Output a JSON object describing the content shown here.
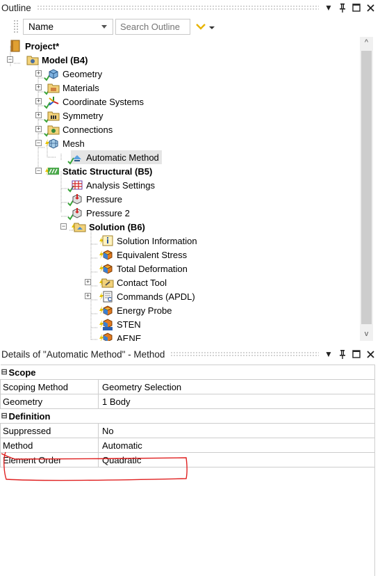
{
  "outline": {
    "title": "Outline",
    "column_select": "Name",
    "search_placeholder": "Search Outline",
    "tree": [
      {
        "label": "Project*",
        "bold": true
      },
      {
        "label": "Model (B4)",
        "bold": true
      },
      {
        "label": "Geometry"
      },
      {
        "label": "Materials"
      },
      {
        "label": "Coordinate Systems"
      },
      {
        "label": "Symmetry"
      },
      {
        "label": "Connections"
      },
      {
        "label": "Mesh"
      },
      {
        "label": "Automatic Method"
      },
      {
        "label": "Static Structural (B5)",
        "bold": true
      },
      {
        "label": "Analysis Settings"
      },
      {
        "label": "Pressure"
      },
      {
        "label": "Pressure 2"
      },
      {
        "label": "Solution (B6)",
        "bold": true
      },
      {
        "label": "Solution Information"
      },
      {
        "label": "Equivalent Stress"
      },
      {
        "label": "Total Deformation"
      },
      {
        "label": "Contact Tool"
      },
      {
        "label": "Commands (APDL)"
      },
      {
        "label": "Energy Probe"
      },
      {
        "label": "STEN"
      },
      {
        "label": "AENE"
      }
    ]
  },
  "details": {
    "title": "Details of \"Automatic Method\" - Method",
    "groups": [
      {
        "name": "Scope",
        "rows": [
          {
            "key": "Scoping Method",
            "value": "Geometry Selection"
          },
          {
            "key": "Geometry",
            "value": "1 Body"
          }
        ]
      },
      {
        "name": "Definition",
        "rows": [
          {
            "key": "Suppressed",
            "value": "No"
          },
          {
            "key": "Method",
            "value": "Automatic"
          },
          {
            "key": "Element Order",
            "value": "Quadratic"
          }
        ]
      }
    ]
  },
  "icons": {
    "pin": "pin-icon",
    "maximize": "maximize-icon",
    "close": "close-icon",
    "dropdown": "chevron-down-icon",
    "filter": "filter-icon"
  },
  "colors": {
    "check_green": "#3aa53a",
    "annotation_red": "#e02020",
    "lightning_yellow": "#e8c400"
  }
}
